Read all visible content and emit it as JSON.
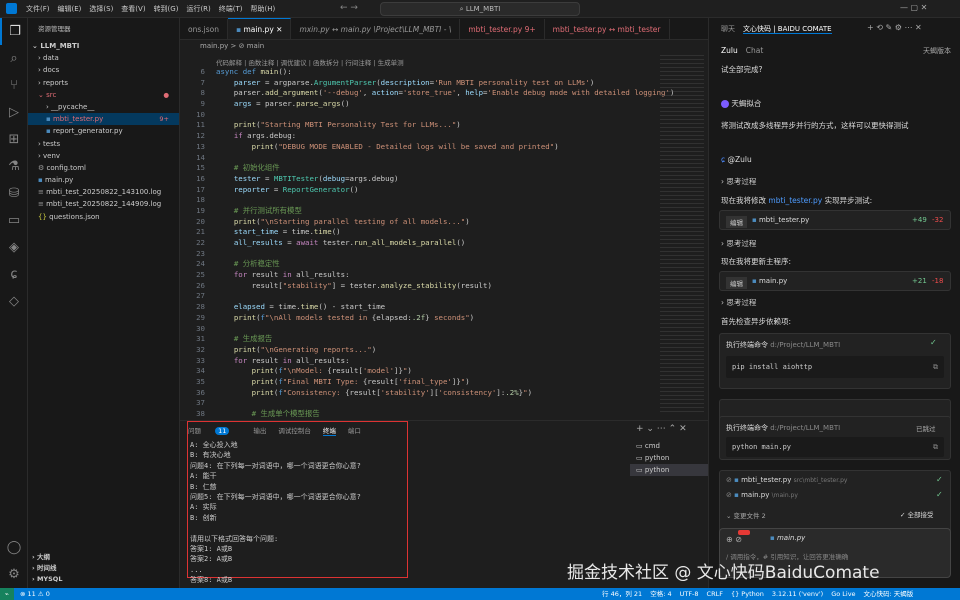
{
  "menu": [
    "文件(F)",
    "编辑(E)",
    "选择(S)",
    "查看(V)",
    "转到(G)",
    "运行(R)",
    "终端(T)",
    "帮助(H)"
  ],
  "search": "LLM_MBTI",
  "explorer": {
    "title": "资源管理器",
    "root": "LLM_MBTI",
    "items": [
      "data",
      "docs",
      "reports",
      "src",
      "__pycache__",
      "mbti_tester.py",
      "report_generator.py",
      "tests",
      "venv",
      "config.toml",
      "main.py",
      "mbti_test_20250822_143100.log",
      "mbti_test_20250822_144909.log",
      "questions.json"
    ],
    "badges": {
      "src": "●",
      "mbti_tester": "9+"
    },
    "sections": [
      "大纲",
      "时间线",
      "MYSQL"
    ]
  },
  "tabs": [
    "ons.json",
    "main.py",
    "mxin.py ↔ main.py \\Project\\LLM_MBTI - \\",
    "mbti_tester.py 9+",
    "mbti_tester.py ↔ mbti_tester"
  ],
  "breadcrumb": "main.py > ⊘ main",
  "codelens": "代码解释 | 函数注释 | 调优建议 | 函数拆分 | 行间注释 | 生成单测",
  "panel": {
    "tabs": [
      "问题",
      "输出",
      "调试控制台",
      "终端",
      "端口"
    ],
    "problems_count": "11",
    "terminal": [
      "A: 全心投入地",
      "B: 有决心地",
      "问题4: 在下列每一对词语中，哪一个词语更合你心意?",
      "A: 能干",
      "B: 仁慈",
      "问题5: 在下列每一对词语中，哪一个词语更合你心意?",
      "A: 实际",
      "B: 创新",
      "",
      "请用以下格式回答每个问题:",
      "答案1: A或B",
      "答案2: A或B",
      "...",
      "答案8: A或B"
    ],
    "terminals": [
      "cmd",
      "python",
      "python"
    ]
  },
  "right": {
    "header_tabs": [
      "聊天",
      "文心快码 | BAIDU COMATE"
    ],
    "tab_zulu": "Zulu",
    "tab_chat": "Chat",
    "mode": "天蝎版本",
    "q1": "试全部完成?",
    "assistant": "天蝎拟合",
    "msg1": "将测试改成多线程异步并行的方式，这样可以更快得测试",
    "user": "@Zulu",
    "think": "思考过程",
    "line1_pre": "现在我将修改",
    "line1_link": "mbti_tester.py",
    "line1_post": "实现异步测试:",
    "edit": "编辑",
    "file1": "mbti_tester.py",
    "add1": "+49",
    "del1": "-32",
    "line2": "现在我将更新主程序:",
    "file2": "main.py",
    "add2": "+21",
    "del2": "-18",
    "line3": "首先检查异步依赖项:",
    "run_cmd": "执行终端命令",
    "path": "d:/Project/LLM_MBTI",
    "cmd1": "pip install aiohttp",
    "cmd2": "python main.py",
    "status_run": "已跳过",
    "changed1": "mbti_tester.py",
    "changed1_path": "src\\mbti_tester.py",
    "changed2": "main.py",
    "changed2_path": "\\main.py",
    "changes": "变更文件 2",
    "accept_all": "全部接受",
    "input_file": "main.py",
    "input_placeholder": "/ 调用指令，# 引用知识，让回答更准确确"
  },
  "status": {
    "left": "⊗ 11 ⚠ 0",
    "right": [
      "行 46，列 21",
      "空格: 4",
      "UTF-8",
      "CRLF",
      "{} Python",
      "3.12.11 ('venv')",
      "Go Live",
      "文心快码: 天蝎版"
    ]
  },
  "watermark": "掘金技术社区 @ 文心快码BaiduComate"
}
